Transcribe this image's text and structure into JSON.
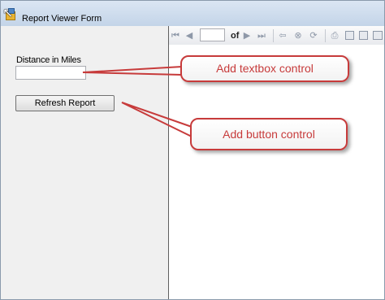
{
  "window": {
    "title": "Report Viewer Form",
    "accent": "#c3d4e8"
  },
  "form": {
    "distance_label": "Distance in Miles",
    "distance_value": "",
    "refresh_label": "Refresh Report"
  },
  "report_toolbar": {
    "page_value": "",
    "of_label": "of",
    "icons": [
      "first-page-icon",
      "previous-page-icon",
      "next-page-icon",
      "last-page-icon",
      "back-icon",
      "stop-icon",
      "refresh-icon",
      "print-icon",
      "print-layout-icon",
      "page-setup-icon",
      "export-icon"
    ]
  },
  "annotations": {
    "textbox_callout": "Add textbox control",
    "button_callout": "Add button control",
    "color": "#c73b3b"
  }
}
